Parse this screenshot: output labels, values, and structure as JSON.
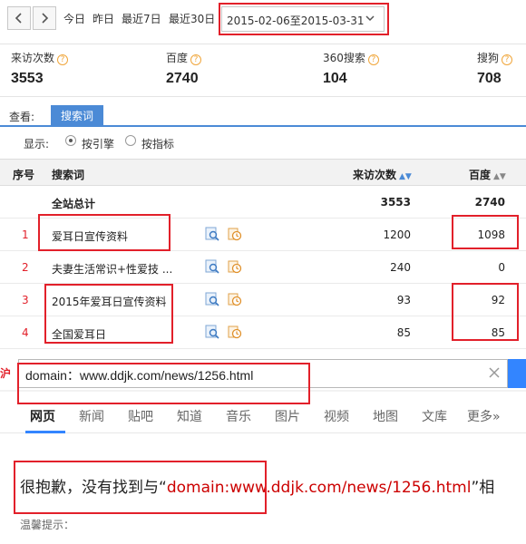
{
  "datebar": {
    "ranges": [
      "今日",
      "昨日",
      "最近7日",
      "最近30日"
    ],
    "selected_range": "2015-02-06至2015-03-31"
  },
  "stats": [
    {
      "label": "来访次数",
      "value": "3553"
    },
    {
      "label": "百度",
      "value": "2740"
    },
    {
      "label": "360搜索",
      "value": "104"
    },
    {
      "label": "搜狗",
      "value": "708"
    }
  ],
  "view": {
    "label": "查看:",
    "tab": "搜索词"
  },
  "display": {
    "label": "显示:",
    "options": [
      "按引擎",
      "按指标"
    ],
    "selected": "按引擎"
  },
  "table": {
    "headers": {
      "index": "序号",
      "keyword": "搜索词",
      "visits": "来访次数",
      "baidu": "百度"
    },
    "total": {
      "keyword": "全站总计",
      "visits": "3553",
      "baidu": "2740"
    },
    "rows": [
      {
        "index": "1",
        "keyword": "爱耳日宣传资料",
        "visits": "1200",
        "baidu": "1098"
      },
      {
        "index": "2",
        "keyword": "夫妻生活常识+性爱技 ...",
        "visits": "240",
        "baidu": "0"
      },
      {
        "index": "3",
        "keyword": "2015年爱耳日宣传资料",
        "visits": "93",
        "baidu": "92"
      },
      {
        "index": "4",
        "keyword": "全国爱耳日",
        "visits": "85",
        "baidu": "85"
      }
    ]
  },
  "search": {
    "query": "domain：www.ddjk.com/news/1256.html",
    "side_char": "沪",
    "tabs": [
      "网页",
      "新闻",
      "贴吧",
      "知道",
      "音乐",
      "图片",
      "视频",
      "地图",
      "文库",
      "更多»"
    ],
    "active_tab": "网页"
  },
  "result": {
    "sorry_prefix": "很抱歉，没有找到与“",
    "sorry_query": "domain:www.ddjk.com/news/1256.html",
    "sorry_suffix": "”相",
    "tip": "温馨提示："
  },
  "colors": {
    "accent": "#4b8ad6",
    "highlight": "#e2202a",
    "baidu_blue": "#3385ff"
  }
}
